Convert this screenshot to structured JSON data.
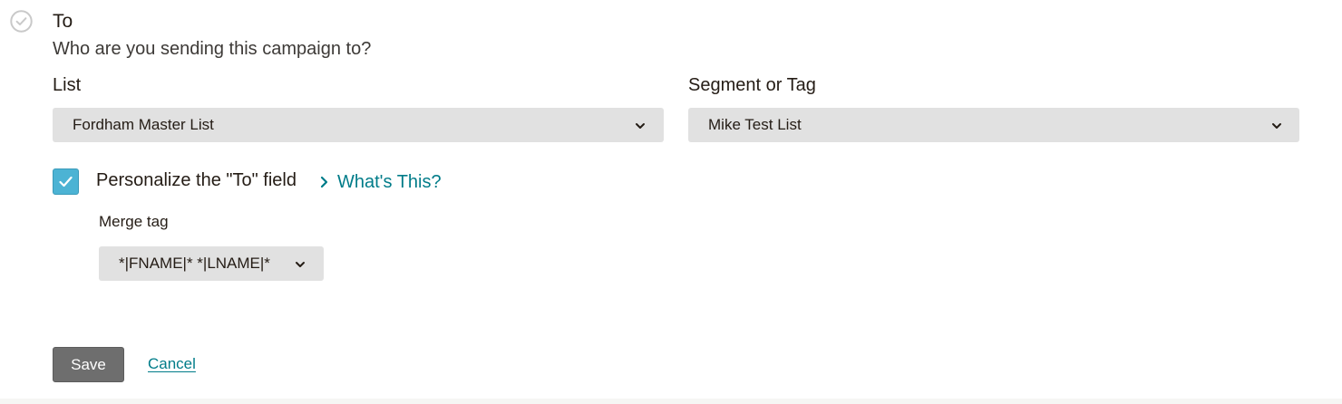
{
  "section": {
    "title": "To",
    "subtitle": "Who are you sending this campaign to?",
    "status_icon": "check-circle-icon"
  },
  "list_field": {
    "label": "List",
    "selected": "Fordham Master List"
  },
  "segment_field": {
    "label": "Segment or Tag",
    "selected": "Mike Test List"
  },
  "personalize": {
    "checked": true,
    "label": "Personalize the \"To\" field",
    "help_link": "What's This?"
  },
  "merge_tag": {
    "label": "Merge tag",
    "selected": "*|FNAME|* *|LNAME|*"
  },
  "actions": {
    "save_label": "Save",
    "cancel_label": "Cancel"
  },
  "colors": {
    "accent_link": "#007c89",
    "checkbox": "#4cb3d4",
    "select_bg": "#e1e1e1",
    "save_button": "#6e6e6e"
  }
}
